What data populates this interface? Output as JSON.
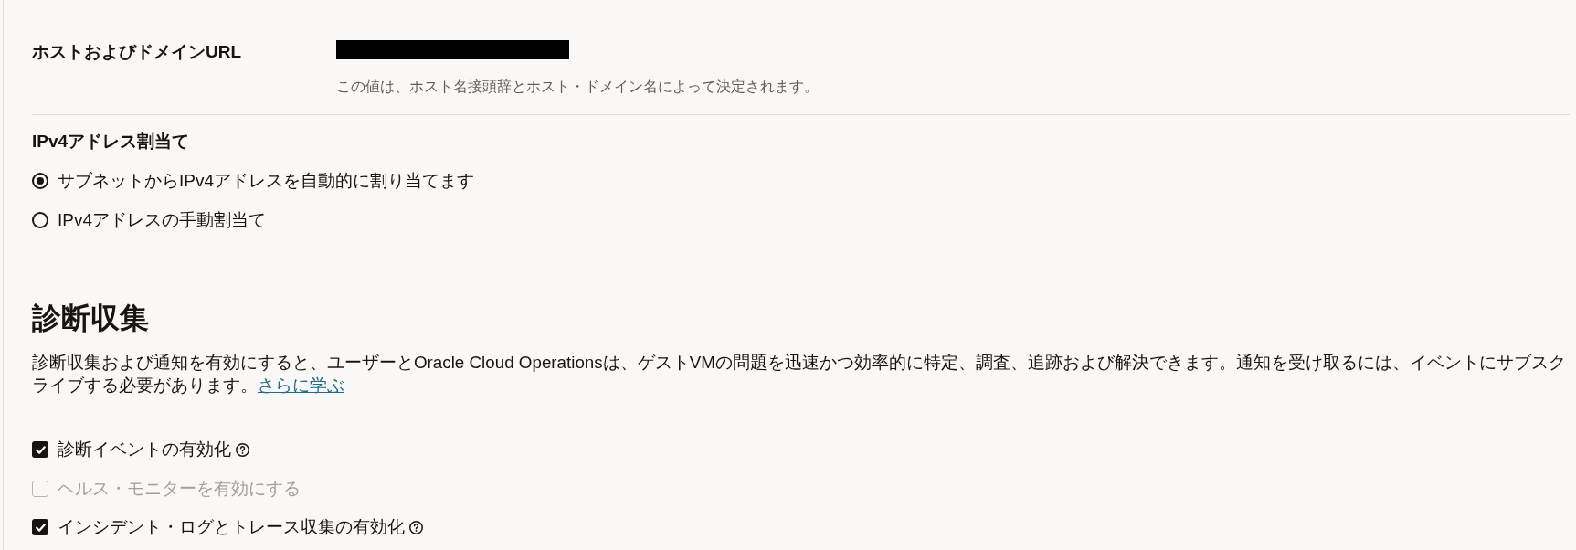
{
  "host_domain_url": {
    "label": "ホストおよびドメインURL",
    "hint": "この値は、ホスト名接頭辞とホスト・ドメイン名によって決定されます。"
  },
  "ipv4_assignment": {
    "label": "IPv4アドレス割当て",
    "options": [
      {
        "label": "サブネットからIPv4アドレスを自動的に割り当てます",
        "selected": true
      },
      {
        "label": "IPv4アドレスの手動割当て",
        "selected": false
      }
    ]
  },
  "diagnostics": {
    "heading": "診断収集",
    "description": "診断収集および通知を有効にすると、ユーザーとOracle Cloud Operationsは、ゲストVMの問題を迅速かつ効率的に特定、調査、追跡および解決できます。通知を受け取るには、イベントにサブスクライブする必要があります。",
    "link": "さらに学ぶ",
    "options": [
      {
        "label": "診断イベントの有効化",
        "checked": true,
        "disabled": false,
        "help": true
      },
      {
        "label": "ヘルス・モニターを有効にする",
        "checked": false,
        "disabled": true,
        "help": false
      },
      {
        "label": "インシデント・ログとトレース収集の有効化",
        "checked": true,
        "disabled": false,
        "help": true
      }
    ]
  }
}
